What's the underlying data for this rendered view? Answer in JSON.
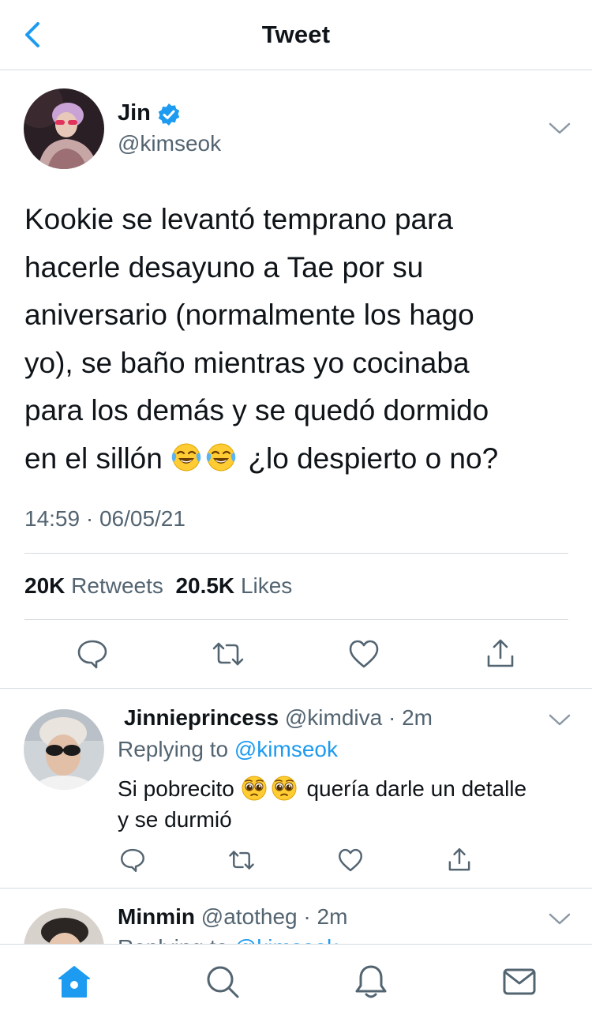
{
  "header": {
    "title": "Tweet"
  },
  "tweet": {
    "author_name": "Jin",
    "author_handle": "@kimseok",
    "body_lines": [
      "Kookie se levantó temprano para",
      "hacerle desayuno a Tae por su",
      "aniversario (normalmente los hago",
      "yo), se baño mientras yo cocinaba",
      "para los demás y se quedó dormido"
    ],
    "body_last_prefix": "en el sillón",
    "body_last_suffix": "¿lo despierto o no?",
    "body_emojis": [
      "face-with-tears-of-joy",
      "face-with-tears-of-joy"
    ],
    "timestamp": "14:59 · 06/05/21",
    "retweets_count": "20K",
    "retweets_label": "Retweets",
    "likes_count": "20.5K",
    "likes_label": "Likes"
  },
  "replies": [
    {
      "name": "Jinnieprincess",
      "handle_meta": "@kimdiva · 2m",
      "replying_label": "Replying to",
      "replying_to": "@kimseok",
      "text_before": "Si pobrecito",
      "text_emojis": [
        "pleading-face",
        "pleading-face"
      ],
      "text_after": "quería darle un detalle",
      "text_line2": "y se durmió"
    },
    {
      "name": "Minmin",
      "handle_meta": "@atotheg · 2m",
      "replying_label": "Replying to",
      "replying_to": "@kimseok"
    }
  ],
  "tabs": [
    "home-icon",
    "search-icon",
    "notifications-icon",
    "messages-icon"
  ],
  "colors": {
    "accent": "#1d9bf0",
    "text": "#0f1419",
    "secondary": "#536471",
    "divider": "#d6dbe0"
  }
}
